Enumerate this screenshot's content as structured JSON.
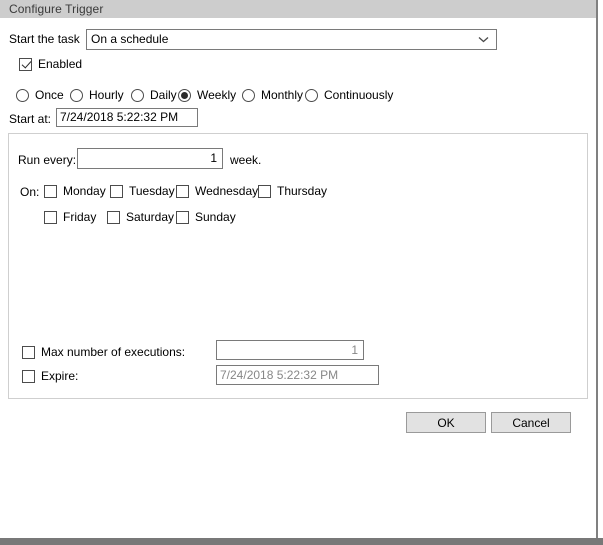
{
  "window": {
    "title": "Configure Trigger"
  },
  "start_task": {
    "label": "Start the task",
    "value": "On a schedule",
    "chevron_icon": "chevron-down-icon"
  },
  "enabled": {
    "label": "Enabled",
    "checked": true
  },
  "schedule_types": [
    {
      "label": "Once",
      "selected": false
    },
    {
      "label": "Hourly",
      "selected": false
    },
    {
      "label": "Daily",
      "selected": false
    },
    {
      "label": "Weekly",
      "selected": true
    },
    {
      "label": "Monthly",
      "selected": false
    },
    {
      "label": "Continuously",
      "selected": false
    }
  ],
  "start_at": {
    "label": "Start at:",
    "value": "7/24/2018 5:22:32 PM"
  },
  "recurrence": {
    "run_every_label": "Run every:",
    "run_every_value": "1",
    "unit_label": "week.",
    "on_label": "On:"
  },
  "days": [
    {
      "label": "Monday",
      "checked": false
    },
    {
      "label": "Tuesday",
      "checked": false
    },
    {
      "label": "Wednesday",
      "checked": false
    },
    {
      "label": "Thursday",
      "checked": false
    },
    {
      "label": "Friday",
      "checked": false
    },
    {
      "label": "Saturday",
      "checked": false
    },
    {
      "label": "Sunday",
      "checked": false
    }
  ],
  "limits": {
    "max_executions_label": "Max number of executions:",
    "max_executions_checked": false,
    "max_executions_value": "1",
    "expire_label": "Expire:",
    "expire_checked": false,
    "expire_value": "7/24/2018 5:22:32 PM"
  },
  "actions": {
    "ok_label": "OK",
    "cancel_label": "Cancel"
  },
  "colors": {
    "titlebar_bg": "#cdcdcd",
    "panel_border": "#cfcfcf",
    "field_border": "#7a7a7a",
    "button_bg": "#e2e2e2",
    "disabled_text": "#878787",
    "bottom_bar": "#787878"
  }
}
